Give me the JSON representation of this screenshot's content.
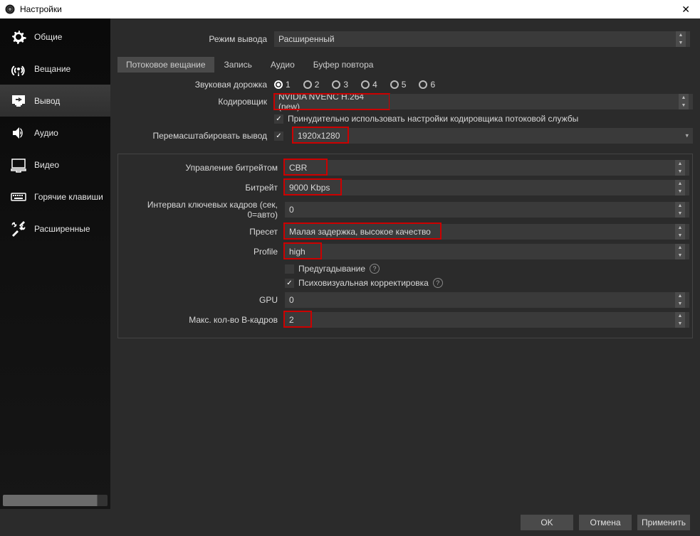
{
  "window": {
    "title": "Настройки"
  },
  "sidebar": {
    "items": [
      {
        "label": "Общие"
      },
      {
        "label": "Вещание"
      },
      {
        "label": "Вывод"
      },
      {
        "label": "Аудио"
      },
      {
        "label": "Видео"
      },
      {
        "label": "Горячие клавиши"
      },
      {
        "label": "Расширенные"
      }
    ]
  },
  "content": {
    "output_mode_label": "Режим вывода",
    "output_mode_value": "Расширенный",
    "tabs": {
      "streaming": "Потоковое вещание",
      "recording": "Запись",
      "audio": "Аудио",
      "replay_buffer": "Буфер повтора"
    },
    "audio_track_label": "Звуковая дорожка",
    "audio_tracks": [
      "1",
      "2",
      "3",
      "4",
      "5",
      "6"
    ],
    "encoder_label": "Кодировщик",
    "encoder_value": "NVIDIA NVENC H.264 (new)",
    "enforce_label": "Принудительно использовать настройки кодировщика потоковой службы",
    "rescale_label": "Перемасштабировать вывод",
    "rescale_value": "1920x1280",
    "rate_control_label": "Управление битрейтом",
    "rate_control_value": "CBR",
    "bitrate_label": "Битрейт",
    "bitrate_value": "9000 Kbps",
    "keyint_label": "Интервал ключевых кадров (сек, 0=авто)",
    "keyint_value": "0",
    "preset_label": "Пресет",
    "preset_value": "Малая задержка, высокое качество",
    "profile_label": "Profile",
    "profile_value": "high",
    "lookahead_label": "Предугадывание",
    "psycho_label": "Психовизуальная корректировка",
    "gpu_label": "GPU",
    "gpu_value": "0",
    "bframes_label": "Макс. кол-во B-кадров",
    "bframes_value": "2"
  },
  "footer": {
    "ok": "OK",
    "cancel": "Отмена",
    "apply": "Применить"
  }
}
